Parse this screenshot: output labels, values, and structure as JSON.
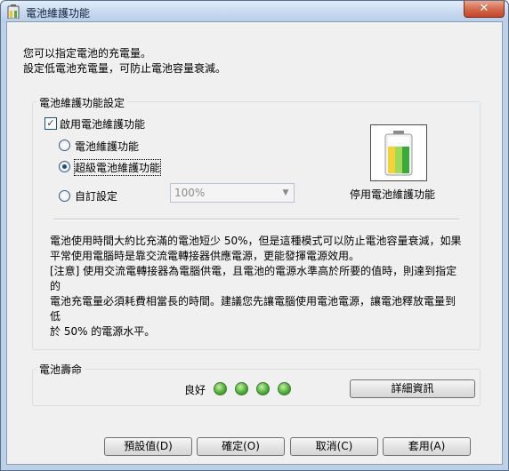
{
  "window": {
    "title": "電池維護功能",
    "close_glyph": "✕"
  },
  "intro": {
    "line1": "您可以指定電池的充電量。",
    "line2": "設定低電池充電量，可防止電池容量衰減。"
  },
  "settings_group": {
    "title": "電池維護功能設定",
    "enable_checkbox": {
      "label": "啟用電池維護功能",
      "checked": true
    },
    "options": [
      {
        "label": "電池維護功能",
        "selected": false
      },
      {
        "label": "超級電池維護功能",
        "selected": true
      },
      {
        "label": "自訂設定",
        "selected": false
      }
    ],
    "custom_value": "100%",
    "status_label": "停用電池維護功能",
    "description": [
      "電池使用時間大約比充滿的電池短少 50%，但是這種模式可以防止電池容量衰減，如果",
      "平常使用電腦時是靠交流電轉接器供應電源，更能發揮電源效用。",
      "[注意] 使用交流電轉接器為電腦供電，且電池的電源水準高於所要的值時，則達到指定的",
      "電池充電量必須耗費相當長的時間。建議您先讓電腦使用電池電源，讓電池釋放電量到低",
      "於 50% 的電源水平。"
    ]
  },
  "life_group": {
    "title": "電池壽命",
    "status": "良好",
    "indicator_count": 4,
    "details_button": "詳細資訊"
  },
  "footer": {
    "defaults": "預設值(D)",
    "ok": "確定(O)",
    "cancel": "取消(C)",
    "apply": "套用(A)"
  },
  "colors": {
    "accent": "#1b4f8a",
    "led_green": "#4fae3a"
  }
}
